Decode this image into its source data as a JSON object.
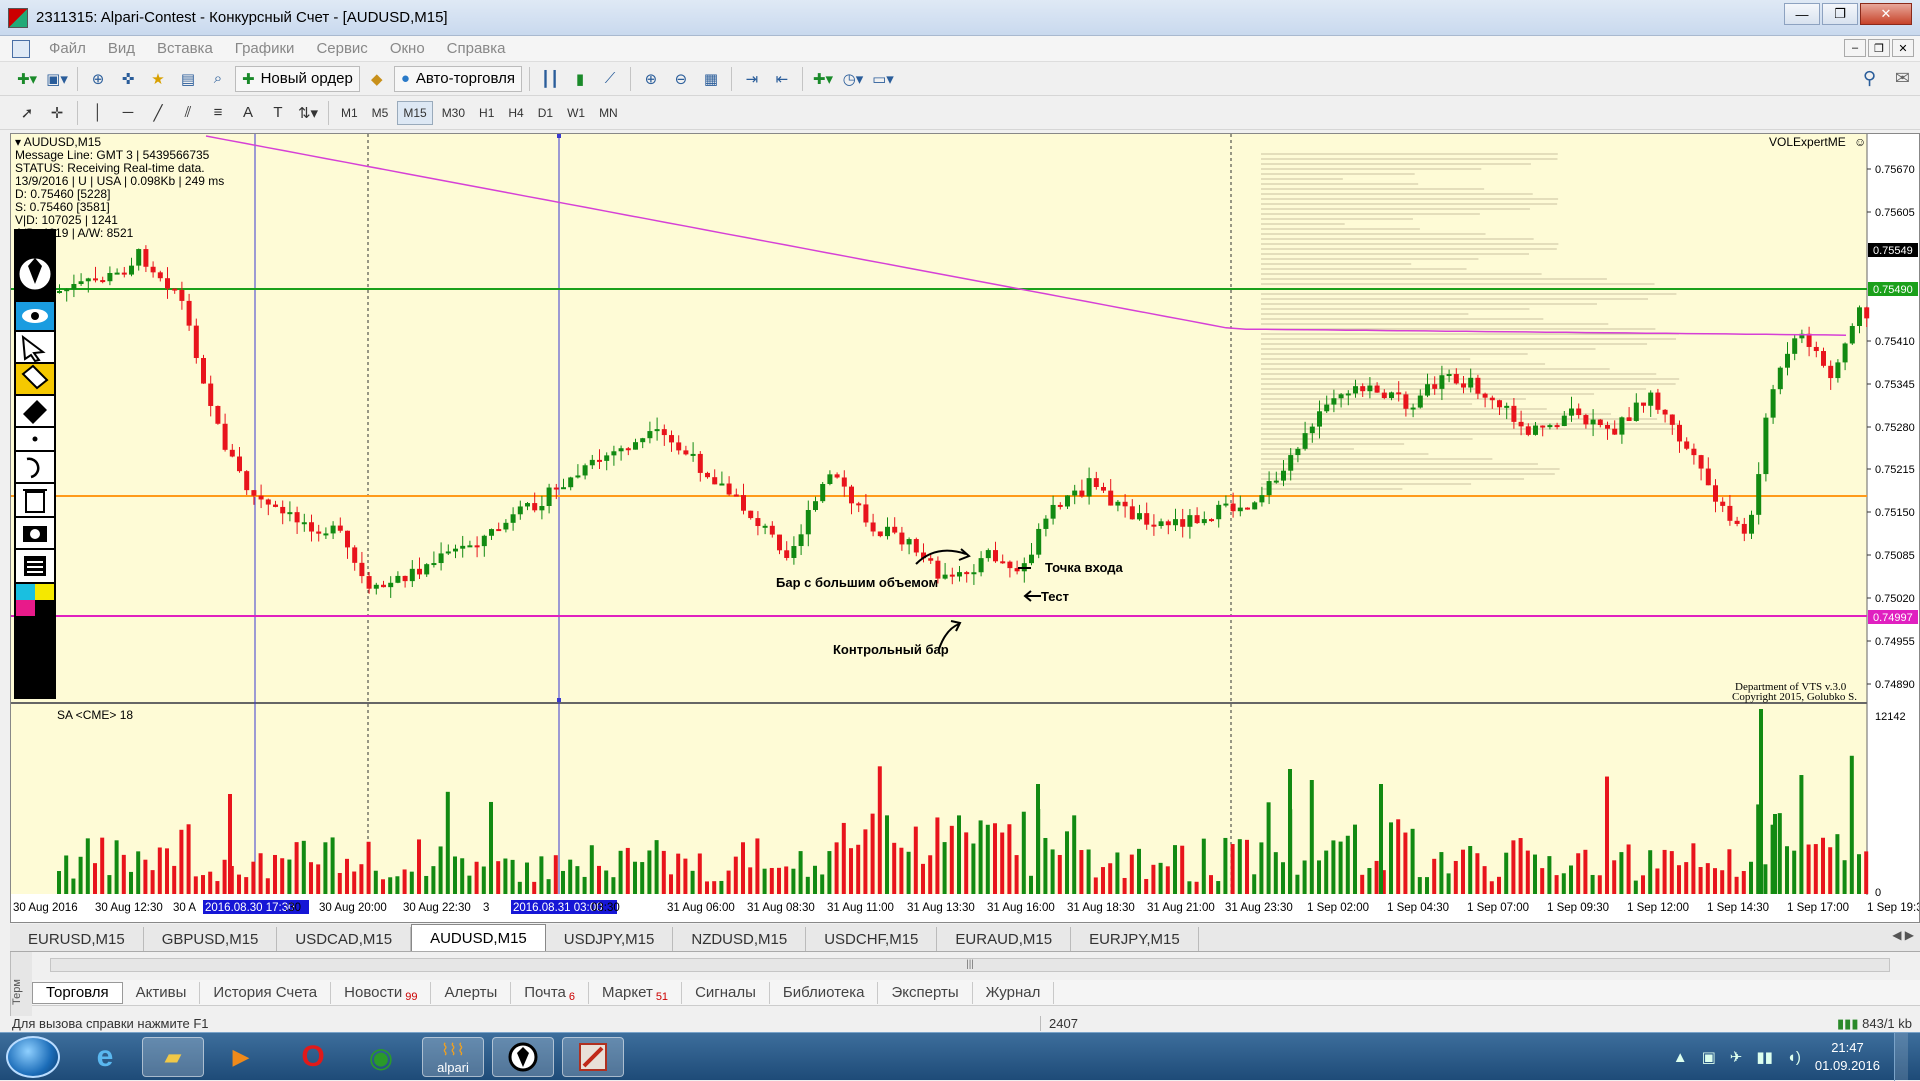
{
  "window": {
    "title": "2311315: Alpari-Contest - Конкурсный Счет - [AUDUSD,M15]",
    "buttons": [
      "—",
      "❐",
      "✕"
    ]
  },
  "menu": {
    "items": [
      "Файл",
      "Вид",
      "Вставка",
      "Графики",
      "Сервис",
      "Окно",
      "Справка"
    ]
  },
  "toolbar": {
    "new_order_label": "Новый ордер",
    "auto_trading_label": "Авто-торговля",
    "timeframes": [
      "M1",
      "M5",
      "M15",
      "M30",
      "H1",
      "H4",
      "D1",
      "W1",
      "MN"
    ],
    "active_timeframe": "M15"
  },
  "chart": {
    "symbol_label": "AUDUSD,M15",
    "info_lines": [
      "Message Line: GMT 3 | 5439566735",
      "STATUS:  Receiving Real-time data.",
      "13/9/2016 | U | USA | 0.098Kb | 249 ms",
      "D: 0.75460  [5228]",
      "S: 0.75460  [3581]",
      "V|D: 107025 | 1241",
      "A/D: 4619 | A/W: 8521"
    ],
    "indicator_name": "VOLExpertME",
    "copyright_lines": [
      "Department of VTS  v.3.0",
      "Copyright 2015, Golubko S."
    ],
    "volume_label": "SA <CME> 18",
    "price_ticks": [
      "0.75670",
      "0.75605",
      "0.75410",
      "0.75345",
      "0.75280",
      "0.75215",
      "0.75150",
      "0.75085",
      "0.75020",
      "0.74955",
      "0.74890"
    ],
    "price_highlight_1": "0.75549",
    "price_highlight_2": "0.75490",
    "price_highlight_3": "0.74997",
    "volume_ticks": [
      "12142",
      "0"
    ],
    "time_ticks": [
      "30 Aug 2016",
      "30 Aug 12:30",
      "30 A",
      "2016.08.30 17:30",
      ":30",
      "30 Aug 20:00",
      "30 Aug 22:30",
      "3",
      "2016.08.31 03:00",
      "03:30",
      "31 Aug 06:00",
      "31 Aug 08:30",
      "31 Aug 11:00",
      "31 Aug 13:30",
      "31 Aug 16:00",
      "31 Aug 18:30",
      "31 Aug 21:00",
      "31 Aug 23:30",
      "1 Sep 02:00",
      "1 Sep 04:30",
      "1 Sep 07:00",
      "1 Sep 09:30",
      "1 Sep 12:00",
      "1 Sep 14:30",
      "1 Sep 17:00",
      "1 Sep 19:30"
    ],
    "annotations": {
      "big_volume_bar": "Бар с большим объемом",
      "entry_point": "Точка входа",
      "test": "Тест",
      "control_bar": "Контрольный бар"
    },
    "colors": {
      "background": "#fefbd6",
      "bull": "#128a12",
      "bear": "#e8141c",
      "ma_line": "#d640d6",
      "support_line": "#e020c0",
      "orange_line": "#ff9a1a",
      "green_line": "#1aa01a",
      "vertical_blue": "#3a3ad0"
    }
  },
  "symbol_tabs": {
    "items": [
      "EURUSD,M15",
      "GBPUSD,M15",
      "USDCAD,M15",
      "AUDUSD,M15",
      "USDJPY,M15",
      "NZDUSD,M15",
      "USDCHF,M15",
      "EURAUD,M15",
      "EURJPY,M15"
    ],
    "active": "AUDUSD,M15"
  },
  "terminal": {
    "side_label": "Терм",
    "tabs": [
      {
        "label": "Торговля",
        "badge": ""
      },
      {
        "label": "Активы",
        "badge": ""
      },
      {
        "label": "История Счета",
        "badge": ""
      },
      {
        "label": "Новости",
        "badge": "99"
      },
      {
        "label": "Алерты",
        "badge": ""
      },
      {
        "label": "Почта",
        "badge": "6"
      },
      {
        "label": "Маркет",
        "badge": "51"
      },
      {
        "label": "Сигналы",
        "badge": ""
      },
      {
        "label": "Библиотека",
        "badge": ""
      },
      {
        "label": "Эксперты",
        "badge": ""
      },
      {
        "label": "Журнал",
        "badge": ""
      }
    ]
  },
  "statusbar": {
    "help": "Для вызова справки нажмите F1",
    "count": "2407",
    "traffic": "843/1 kb"
  },
  "taskbar": {
    "apps": [
      "ie-icon",
      "folder-icon",
      "media-icon",
      "opera-icon",
      "chrome-icon",
      "alpari-icon",
      "pen-tool-icon",
      "app-icon"
    ],
    "alpari_label": "alpari",
    "time": "21:47",
    "date": "01.09.2016"
  }
}
